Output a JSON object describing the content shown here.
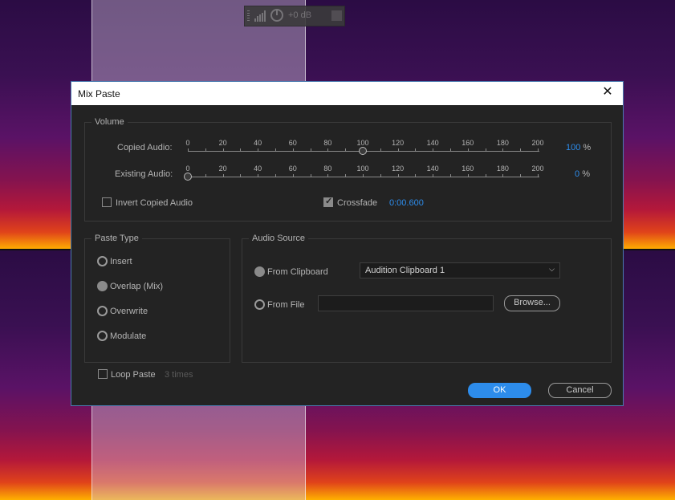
{
  "hud": {
    "gain": "+0 dB"
  },
  "dialog": {
    "title": "Mix Paste",
    "close": "✕",
    "volume": {
      "legend": "Volume",
      "scale": [
        "0",
        "20",
        "40",
        "60",
        "80",
        "100",
        "120",
        "140",
        "160",
        "180",
        "200"
      ],
      "copied_label": "Copied Audio:",
      "copied_value": "100",
      "copied_level": 100,
      "existing_label": "Existing Audio:",
      "existing_value": "0",
      "existing_level": 0,
      "percent": "%",
      "invert_label": "Invert Copied Audio",
      "invert_checked": false,
      "crossfade_label": "Crossfade",
      "crossfade_checked": true,
      "crossfade_value": "0:00.600"
    },
    "paste_type": {
      "legend": "Paste Type",
      "options": [
        "Insert",
        "Overlap (Mix)",
        "Overwrite",
        "Modulate"
      ],
      "selected": "Overlap (Mix)"
    },
    "audio_source": {
      "legend": "Audio Source",
      "clipboard_label": "From Clipboard",
      "clipboard_value": "Audition Clipboard 1",
      "file_label": "From File",
      "file_value": "",
      "browse_label": "Browse..."
    },
    "loop": {
      "label": "Loop Paste",
      "checked": false,
      "times": "3 times"
    },
    "ok_label": "OK",
    "cancel_label": "Cancel"
  },
  "colors": {
    "accent": "#2d8ceb",
    "dialog_bg": "#232323",
    "border": "#4a7ab0"
  }
}
